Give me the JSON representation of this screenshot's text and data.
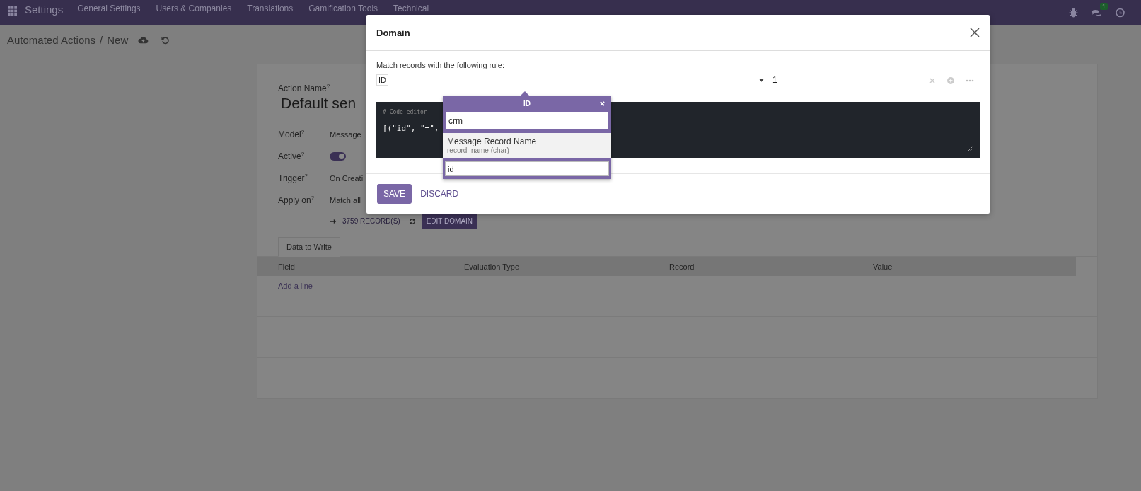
{
  "navbar": {
    "app_name": "Settings",
    "menus": [
      "General Settings",
      "Users & Companies",
      "Translations",
      "Gamification Tools",
      "Technical"
    ],
    "chat_badge": "1"
  },
  "breadcrumb": {
    "parent": "Automated Actions",
    "separator": "/",
    "current": "New"
  },
  "form": {
    "fields": [
      {
        "kind": "title",
        "label": "Action Name",
        "help": "?",
        "value": "Default sen"
      },
      {
        "kind": "text",
        "label": "Model",
        "help": "?",
        "value": "Message"
      },
      {
        "kind": "toggle",
        "label": "Active",
        "help": "?",
        "on": true
      },
      {
        "kind": "text",
        "label": "Trigger",
        "help": "?",
        "value": "On Creati"
      },
      {
        "kind": "text",
        "label": "Apply on",
        "help": "?",
        "value": "Match all"
      }
    ],
    "records_link": "3759 RECORD(S)",
    "edit_domain_button": "EDIT DOMAIN",
    "tabs": [
      {
        "label": "Data to Write",
        "selected": true
      }
    ],
    "table": {
      "columns": [
        "Field",
        "Evaluation Type",
        "Record",
        "Value"
      ],
      "add_line": "Add a line"
    }
  },
  "dialog": {
    "title": "Domain",
    "rule_label": "Match records with the following rule:",
    "field_tag": "ID",
    "operator": "=",
    "value": "1",
    "code_comment": "# Code editor",
    "code": "[(\"id\", \"=\",",
    "popover": {
      "title": "ID",
      "search": "crm",
      "items": [
        {
          "name": "Message Record Name",
          "detail": "record_name (char)"
        }
      ],
      "path": "id"
    },
    "buttons": [
      {
        "label": "SAVE",
        "kind": "primary"
      },
      {
        "label": "DISCARD",
        "kind": "link"
      }
    ]
  }
}
